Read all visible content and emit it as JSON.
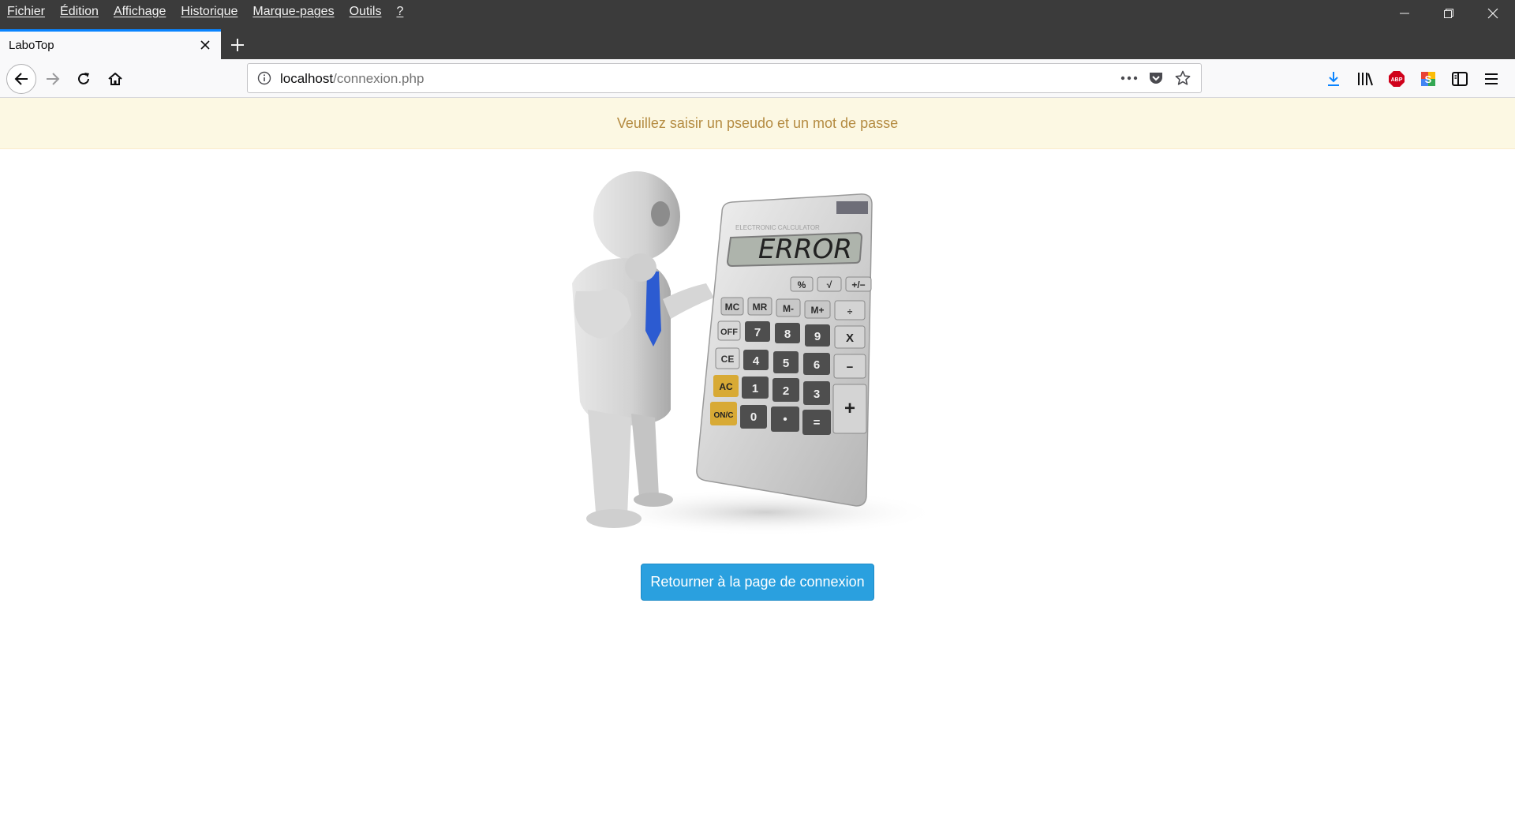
{
  "menu": {
    "items": [
      "Fichier",
      "Édition",
      "Affichage",
      "Historique",
      "Marque-pages",
      "Outils",
      "?"
    ]
  },
  "tab": {
    "title": "LaboTop"
  },
  "urlbar": {
    "host": "localhost",
    "path": "/connexion.php"
  },
  "toolbar": {
    "icons": [
      "download-icon",
      "library-icon",
      "adblock-plus-icon",
      "extension-icon",
      "sidebar-icon",
      "hamburger-menu-icon"
    ]
  },
  "page": {
    "alert_message": "Veuillez saisir un pseudo et un mot de passe",
    "calculator_display": "ERROR",
    "calculator_brand": "ELECTRONIC CALCULATOR",
    "return_button_label": "Retourner à la page de connexion"
  },
  "colors": {
    "accent": "#0a84ff",
    "alert_background": "#fcf8e3",
    "alert_text": "#b48b41",
    "button_background": "#2aa0df"
  }
}
